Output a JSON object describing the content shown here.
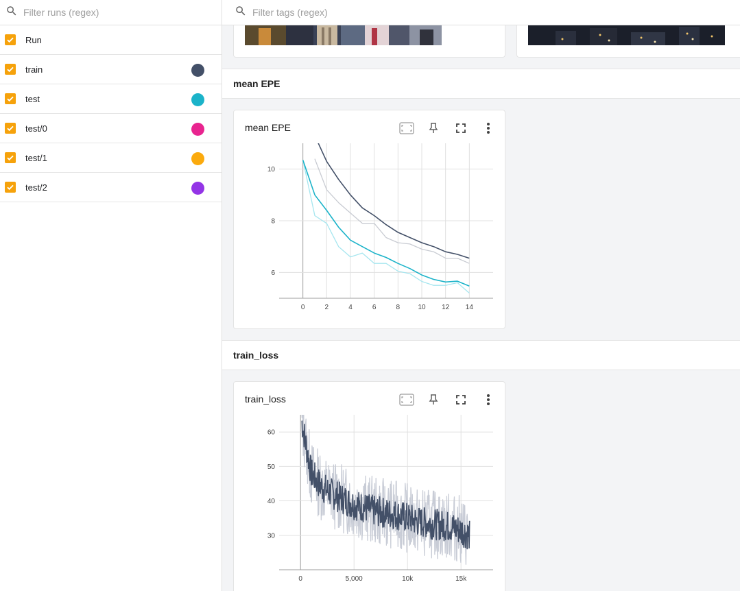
{
  "runs_filter": {
    "placeholder": "Filter runs (regex)"
  },
  "tags_filter": {
    "placeholder": "Filter tags (regex)"
  },
  "runs": [
    {
      "label": "Run",
      "color": null
    },
    {
      "label": "train",
      "color": "#435068"
    },
    {
      "label": "test",
      "color": "#1bb3c9"
    },
    {
      "label": "test/0",
      "color": "#e8248f"
    },
    {
      "label": "test/1",
      "color": "#fbaa0d"
    },
    {
      "label": "test/2",
      "color": "#9334e6"
    }
  ],
  "sections": {
    "mean_epe": {
      "header": "mean EPE",
      "card_title": "mean EPE"
    },
    "train_loss": {
      "header": "train_loss",
      "card_title": "train_loss"
    }
  },
  "icons": {
    "search": "search-icon",
    "fit": "fit-domain-icon",
    "pin": "pin-icon",
    "fullscreen": "fullscreen-icon",
    "more": "more-vert-icon",
    "check": "check-icon"
  },
  "chart_data": [
    {
      "type": "line",
      "title": "mean EPE",
      "x_ticks": [
        0,
        2,
        4,
        6,
        8,
        10,
        12,
        14
      ],
      "y_ticks": [
        6,
        8,
        10
      ],
      "ylim": [
        5.0,
        11.0
      ],
      "xlim": [
        -2,
        16
      ],
      "grid": true,
      "series": [
        {
          "name": "train",
          "color": "#435068",
          "smoothed": true,
          "x": [
            1,
            2,
            3,
            4,
            5,
            6,
            7,
            8,
            9,
            10,
            11,
            12,
            13,
            14
          ],
          "y": [
            11.3,
            10.3,
            9.6,
            9.0,
            8.5,
            8.2,
            7.85,
            7.55,
            7.35,
            7.15,
            7.0,
            6.8,
            6.7,
            6.55
          ]
        },
        {
          "name": "train",
          "color": "#c8cbd2",
          "smoothed": false,
          "x": [
            1,
            2,
            3,
            4,
            5,
            6,
            7,
            8,
            9,
            10,
            11,
            12,
            13,
            14
          ],
          "y": [
            10.4,
            9.2,
            8.7,
            8.3,
            7.9,
            7.9,
            7.35,
            7.15,
            7.1,
            6.9,
            6.8,
            6.55,
            6.55,
            6.35
          ]
        },
        {
          "name": "test",
          "color": "#1bb3c9",
          "smoothed": true,
          "x": [
            0,
            1,
            2,
            3,
            4,
            5,
            6,
            7,
            8,
            9,
            10,
            11,
            12,
            13,
            14
          ],
          "y": [
            10.35,
            9.0,
            8.4,
            7.75,
            7.25,
            7.0,
            6.75,
            6.58,
            6.35,
            6.15,
            5.9,
            5.73,
            5.63,
            5.66,
            5.47
          ]
        },
        {
          "name": "test",
          "color": "#a6e6ef",
          "smoothed": false,
          "x": [
            0,
            1,
            2,
            3,
            4,
            5,
            6,
            7,
            8,
            9,
            10,
            11,
            12,
            13,
            14
          ],
          "y": [
            10.35,
            8.2,
            7.9,
            7.0,
            6.6,
            6.75,
            6.35,
            6.35,
            6.05,
            5.95,
            5.65,
            5.5,
            5.5,
            5.6,
            5.2
          ]
        }
      ]
    },
    {
      "type": "line",
      "title": "train_loss",
      "x_ticks": [
        0,
        5000,
        10000,
        15000
      ],
      "x_tick_labels": [
        "0",
        "5,000",
        "10k",
        "15k"
      ],
      "y_ticks": [
        30,
        40,
        50,
        60
      ],
      "ylim": [
        20,
        65
      ],
      "xlim": [
        -2000,
        18000
      ],
      "grid": true,
      "series": [
        {
          "name": "train",
          "color": "#435068",
          "smoothed": true,
          "trend_x": [
            0,
            1000,
            2000,
            3000,
            4000,
            5000,
            6000,
            7000,
            8000,
            9000,
            10000,
            11000,
            12000,
            13000,
            14000,
            15000,
            15800
          ],
          "trend_y": [
            65,
            48,
            44,
            42,
            40.5,
            39,
            38,
            37,
            36.5,
            36,
            35,
            34,
            33.5,
            33,
            32.5,
            31.5,
            30
          ]
        },
        {
          "name": "train",
          "color": "#c8ccd6",
          "smoothed": false,
          "trend_x": [
            0,
            1000,
            2000,
            3000,
            4000,
            5000,
            6000,
            7000,
            8000,
            9000,
            10000,
            11000,
            12000,
            13000,
            14000,
            15000,
            15800
          ],
          "trend_y": [
            65,
            48,
            44,
            42,
            40.5,
            39,
            38,
            37,
            36.5,
            36,
            35,
            34,
            33.5,
            33,
            32.5,
            31.5,
            30
          ]
        }
      ]
    }
  ]
}
